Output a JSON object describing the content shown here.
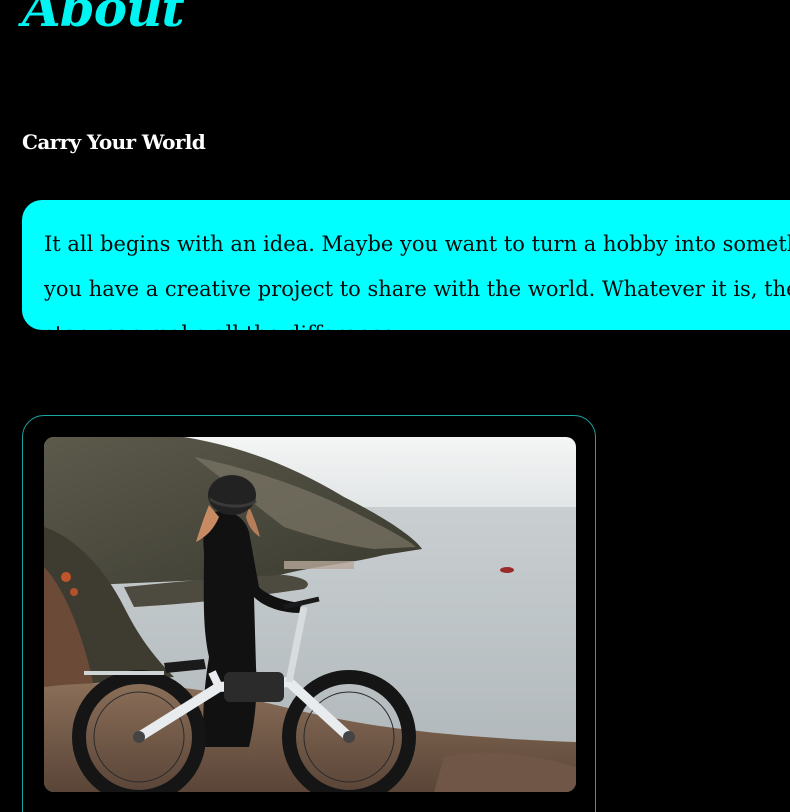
{
  "page": {
    "title": "About",
    "subtitle": "Carry Your World",
    "intro": "It all begins with an idea. Maybe you want to turn a hobby into something more. Or maybe you have a creative project to share with the world. Whatever it is, the way you tell your story can make all the difference."
  },
  "image": {
    "alt": "Woman with helmet standing beside an electric bike on a cliff overlooking the sea"
  },
  "colors": {
    "background": "#000000",
    "accent": "#00ffff",
    "frame_border": "#1aa6a3",
    "subtitle": "#ffffff"
  }
}
